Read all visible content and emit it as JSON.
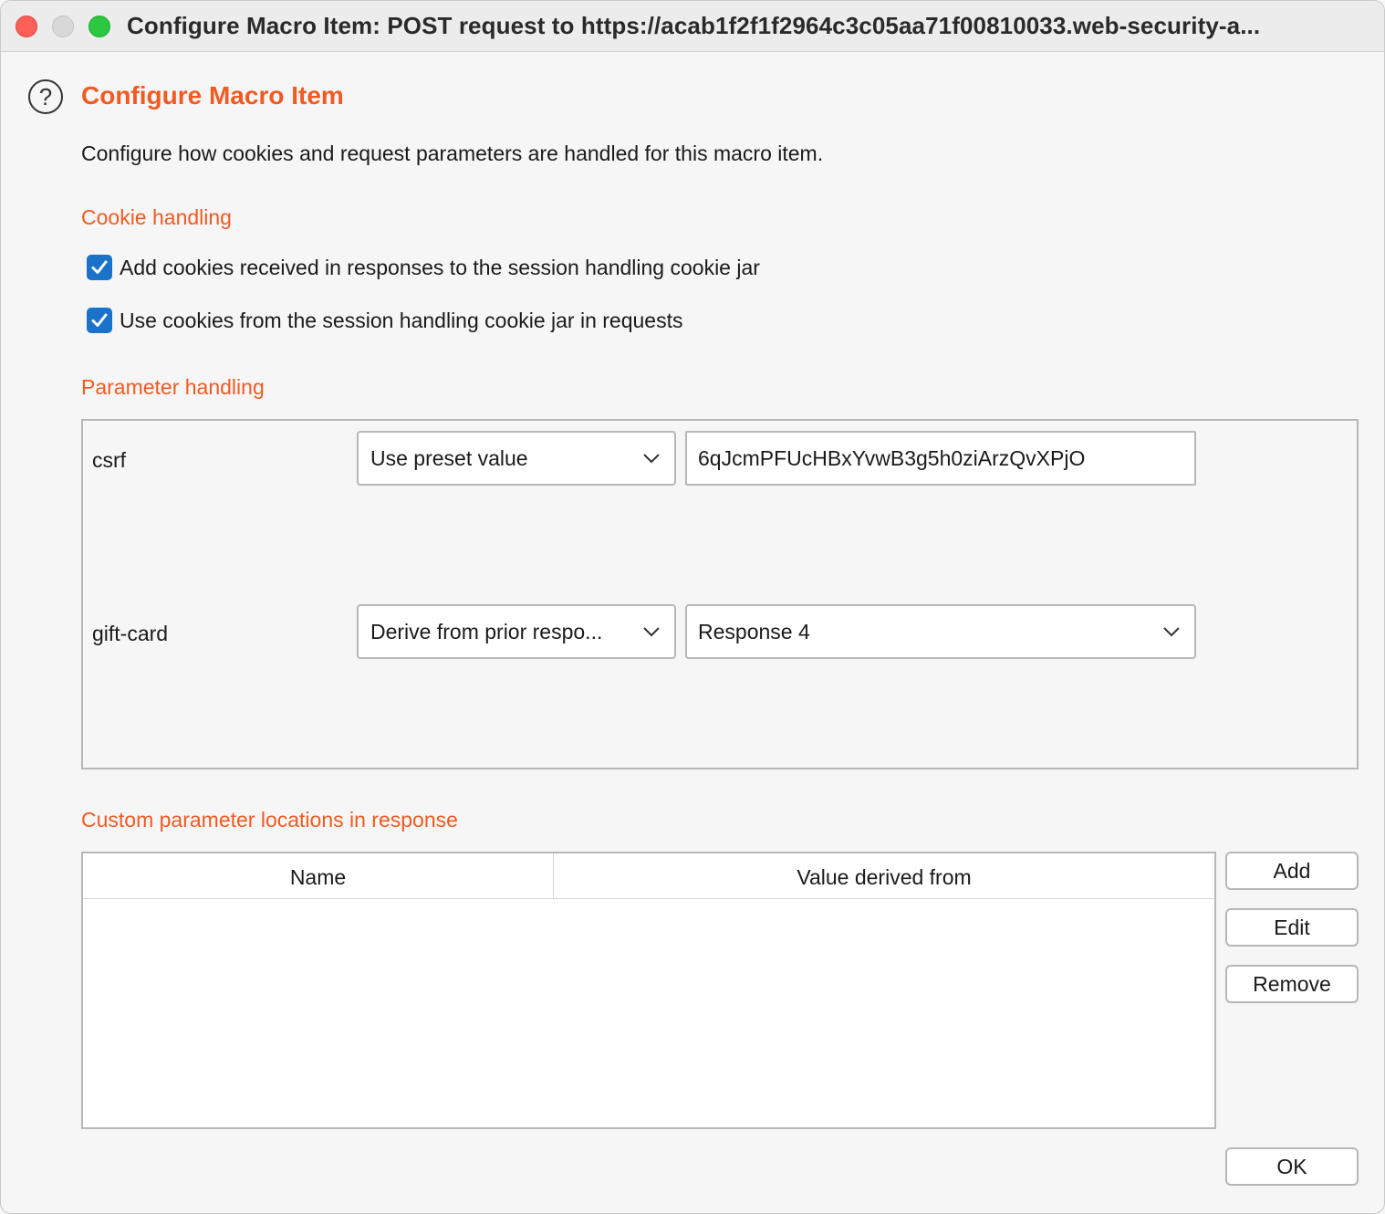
{
  "window": {
    "title": "Configure Macro Item: POST request to https://acab1f2f1f2964c3c05aa71f00810033.web-security-a..."
  },
  "dialog": {
    "heading": "Configure Macro Item",
    "description": "Configure how cookies and request parameters are handled for this macro item."
  },
  "cookie_handling": {
    "label": "Cookie handling",
    "options": [
      {
        "label": "Add cookies received in responses to the session handling cookie jar",
        "checked": true
      },
      {
        "label": "Use cookies from the session handling cookie jar in requests",
        "checked": true
      }
    ]
  },
  "parameter_handling": {
    "label": "Parameter handling",
    "params": [
      {
        "name": "csrf",
        "mode": "Use preset value",
        "value": "6qJcmPFUcHBxYvwB3g5h0ziArzQvXPjO"
      },
      {
        "name": "gift-card",
        "mode": "Derive from prior respo...",
        "value": "Response 4"
      }
    ]
  },
  "custom_locations": {
    "label": "Custom parameter locations in response",
    "columns": [
      "Name",
      "Value derived from"
    ],
    "rows": []
  },
  "buttons": {
    "add": "Add",
    "edit": "Edit",
    "remove": "Remove",
    "ok": "OK"
  },
  "colors": {
    "accent": "#f15a22",
    "checkbox": "#1a73c9"
  }
}
